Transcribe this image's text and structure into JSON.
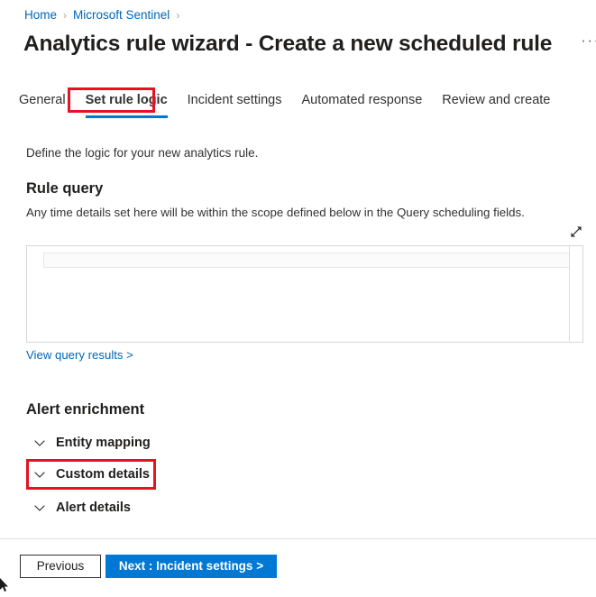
{
  "breadcrumb": {
    "items": [
      {
        "label": "Home"
      },
      {
        "label": "Microsoft Sentinel"
      }
    ],
    "separator": "›"
  },
  "header": {
    "title": "Analytics rule wizard - Create a new scheduled rule",
    "more_menu": "···"
  },
  "tabs": [
    {
      "label": "General",
      "selected": false
    },
    {
      "label": "Set rule logic",
      "selected": true
    },
    {
      "label": "Incident settings",
      "selected": false
    },
    {
      "label": "Automated response",
      "selected": false
    },
    {
      "label": "Review and create",
      "selected": false
    }
  ],
  "main": {
    "intro": "Define the logic for your new analytics rule.",
    "rule_query": {
      "heading": "Rule query",
      "description": "Any time details set here will be within the scope defined below in the Query scheduling fields.",
      "editor_value": "",
      "editor_placeholder": "",
      "expand_icon": "expand-diagonal-icon",
      "results_link": "View query results >"
    },
    "alert_enrichment": {
      "heading": "Alert enrichment",
      "sections": [
        {
          "label": "Entity mapping",
          "icon": "chevron-down-icon",
          "expanded": false
        },
        {
          "label": "Custom details",
          "icon": "chevron-down-icon",
          "expanded": false
        },
        {
          "label": "Alert details",
          "icon": "chevron-down-icon",
          "expanded": false
        }
      ]
    }
  },
  "footer": {
    "previous_label": "Previous",
    "next_label": "Next : Incident settings >"
  },
  "colors": {
    "accent_blue": "#0078d4",
    "link_blue": "#0067b8",
    "highlight_red": "#e81123",
    "text_dark": "#201f1e",
    "divider": "#e1dfdd"
  }
}
